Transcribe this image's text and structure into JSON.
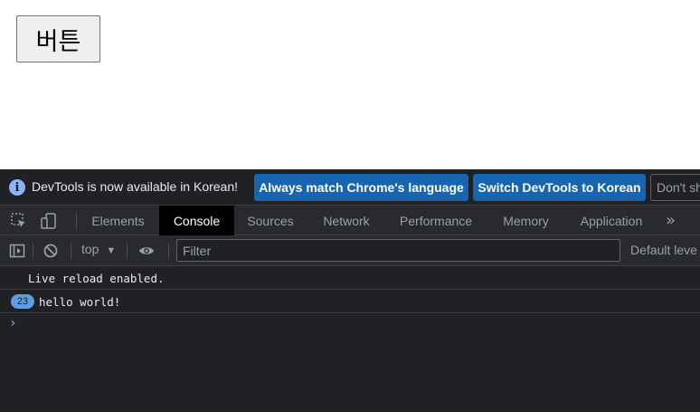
{
  "page": {
    "button_label": "버튼"
  },
  "devtools": {
    "infobar": {
      "message": "DevTools is now available in Korean!",
      "match_language_label": "Always match Chrome's language",
      "switch_label": "Switch DevTools to Korean",
      "dont_show_label": "Don't sh"
    },
    "tabs": [
      {
        "label": "Elements"
      },
      {
        "label": "Console"
      },
      {
        "label": "Sources"
      },
      {
        "label": "Network"
      },
      {
        "label": "Performance"
      },
      {
        "label": "Memory"
      },
      {
        "label": "Application"
      }
    ],
    "active_tab": "Console",
    "toolbar": {
      "context": "top",
      "filter_placeholder": "Filter",
      "levels_label": "Default leve"
    },
    "console_messages": [
      {
        "text": "Live reload enabled.",
        "count": ""
      },
      {
        "text": "hello world!",
        "count": "23"
      }
    ],
    "colors": {
      "background": "#202124",
      "accent_button": "#1765b1",
      "badge": "#5c9ee0",
      "prompt": "#8ab4f8"
    }
  }
}
